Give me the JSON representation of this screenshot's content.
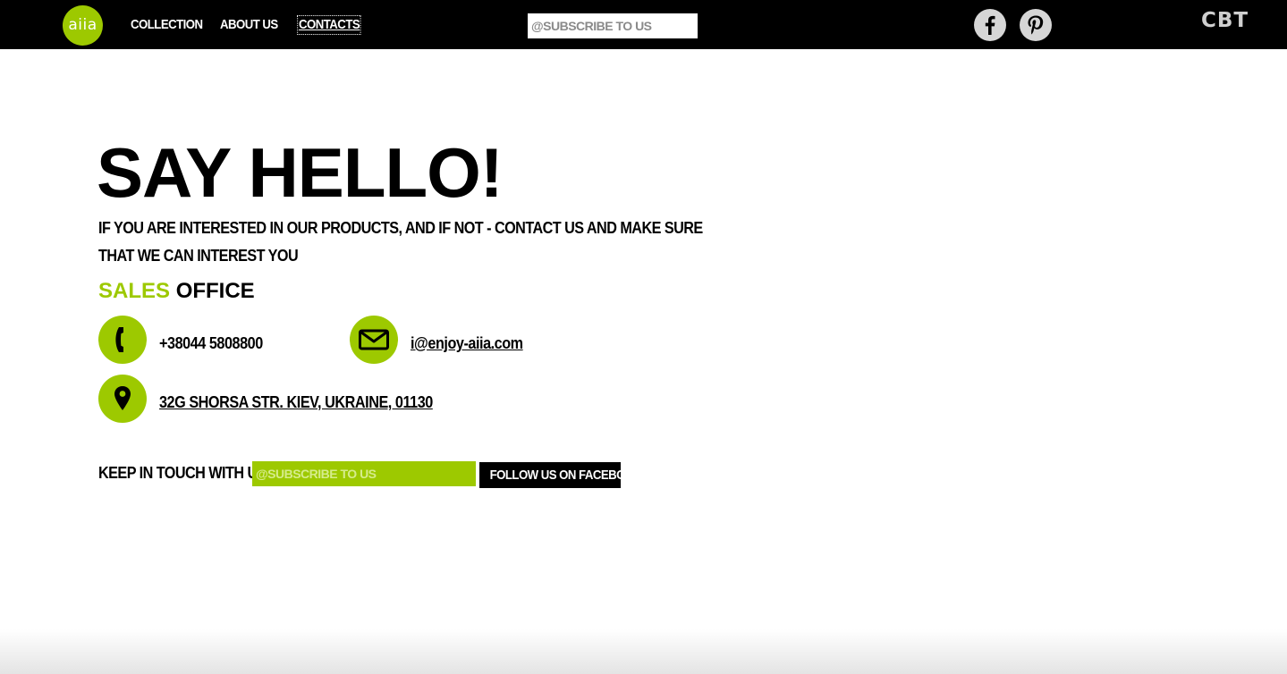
{
  "brand": {
    "logo_text": "aiia",
    "accent_color": "#9dc900"
  },
  "nav": {
    "items": [
      {
        "label": "COLLECTION"
      },
      {
        "label": "ABOUT US"
      },
      {
        "label": "CONTACTS",
        "active": true
      }
    ]
  },
  "header": {
    "subscribe_placeholder": "@SUBSCRIBE TO US",
    "social": [
      "facebook-icon",
      "pinterest-icon"
    ],
    "language": "CBT"
  },
  "main": {
    "title": "SAY HELLO!",
    "intro": "IF YOU ARE INTERESTED IN OUR PRODUCTS, AND IF NOT - CONTACT US AND MAKE SURE THAT WE CAN INTEREST YOU",
    "office_title_accent": "SALES",
    "office_title_rest": "OFFICE",
    "phone": "+38044 5808800",
    "email": "i@enjoy-aiia.com",
    "address": "32G SHORSA STR. KIEV, UKRAINE, 01130"
  },
  "footer_cta": {
    "label": "KEEP IN TOUCH WITH US",
    "subscribe_placeholder": "@SUBSCRIBE TO US",
    "facebook_button": "FOLLOW US ON FACEBOOK"
  }
}
